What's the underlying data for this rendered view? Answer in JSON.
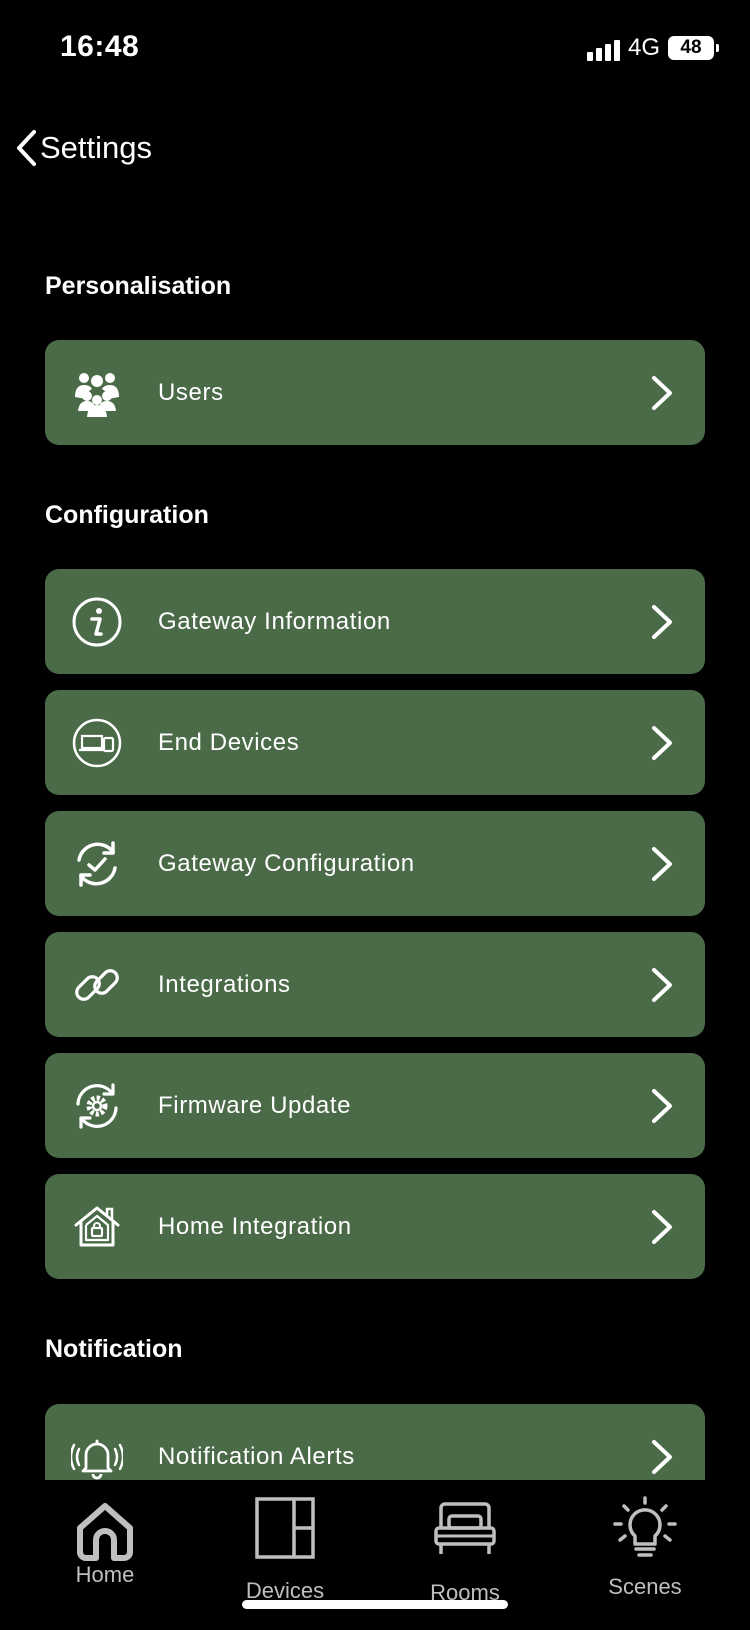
{
  "status_bar": {
    "time": "16:48",
    "network": "4G",
    "battery": "48"
  },
  "header": {
    "title": "Settings"
  },
  "sections": {
    "personalisation": {
      "title": "Personalisation",
      "items": [
        {
          "label": "Users",
          "icon": "users-icon"
        }
      ]
    },
    "configuration": {
      "title": "Configuration",
      "items": [
        {
          "label": "Gateway Information",
          "icon": "info-icon"
        },
        {
          "label": "End Devices",
          "icon": "devices-icon"
        },
        {
          "label": "Gateway Configuration",
          "icon": "sync-check-icon"
        },
        {
          "label": "Integrations",
          "icon": "link-icon"
        },
        {
          "label": "Firmware Update",
          "icon": "gear-sync-icon"
        },
        {
          "label": "Home Integration",
          "icon": "home-lock-icon"
        }
      ]
    },
    "notification": {
      "title": "Notification",
      "items": [
        {
          "label": "Notification Alerts",
          "icon": "bell-icon"
        }
      ]
    }
  },
  "tab_bar": {
    "tabs": [
      {
        "label": "Home",
        "icon": "home-icon"
      },
      {
        "label": "Devices",
        "icon": "devices-panel-icon"
      },
      {
        "label": "Rooms",
        "icon": "bed-icon"
      },
      {
        "label": "Scenes",
        "icon": "lightbulb-icon"
      }
    ]
  },
  "colors": {
    "background": "#000000",
    "row": "#4a6a48",
    "text": "#ffffff",
    "tab_text": "#bfbfbf"
  }
}
